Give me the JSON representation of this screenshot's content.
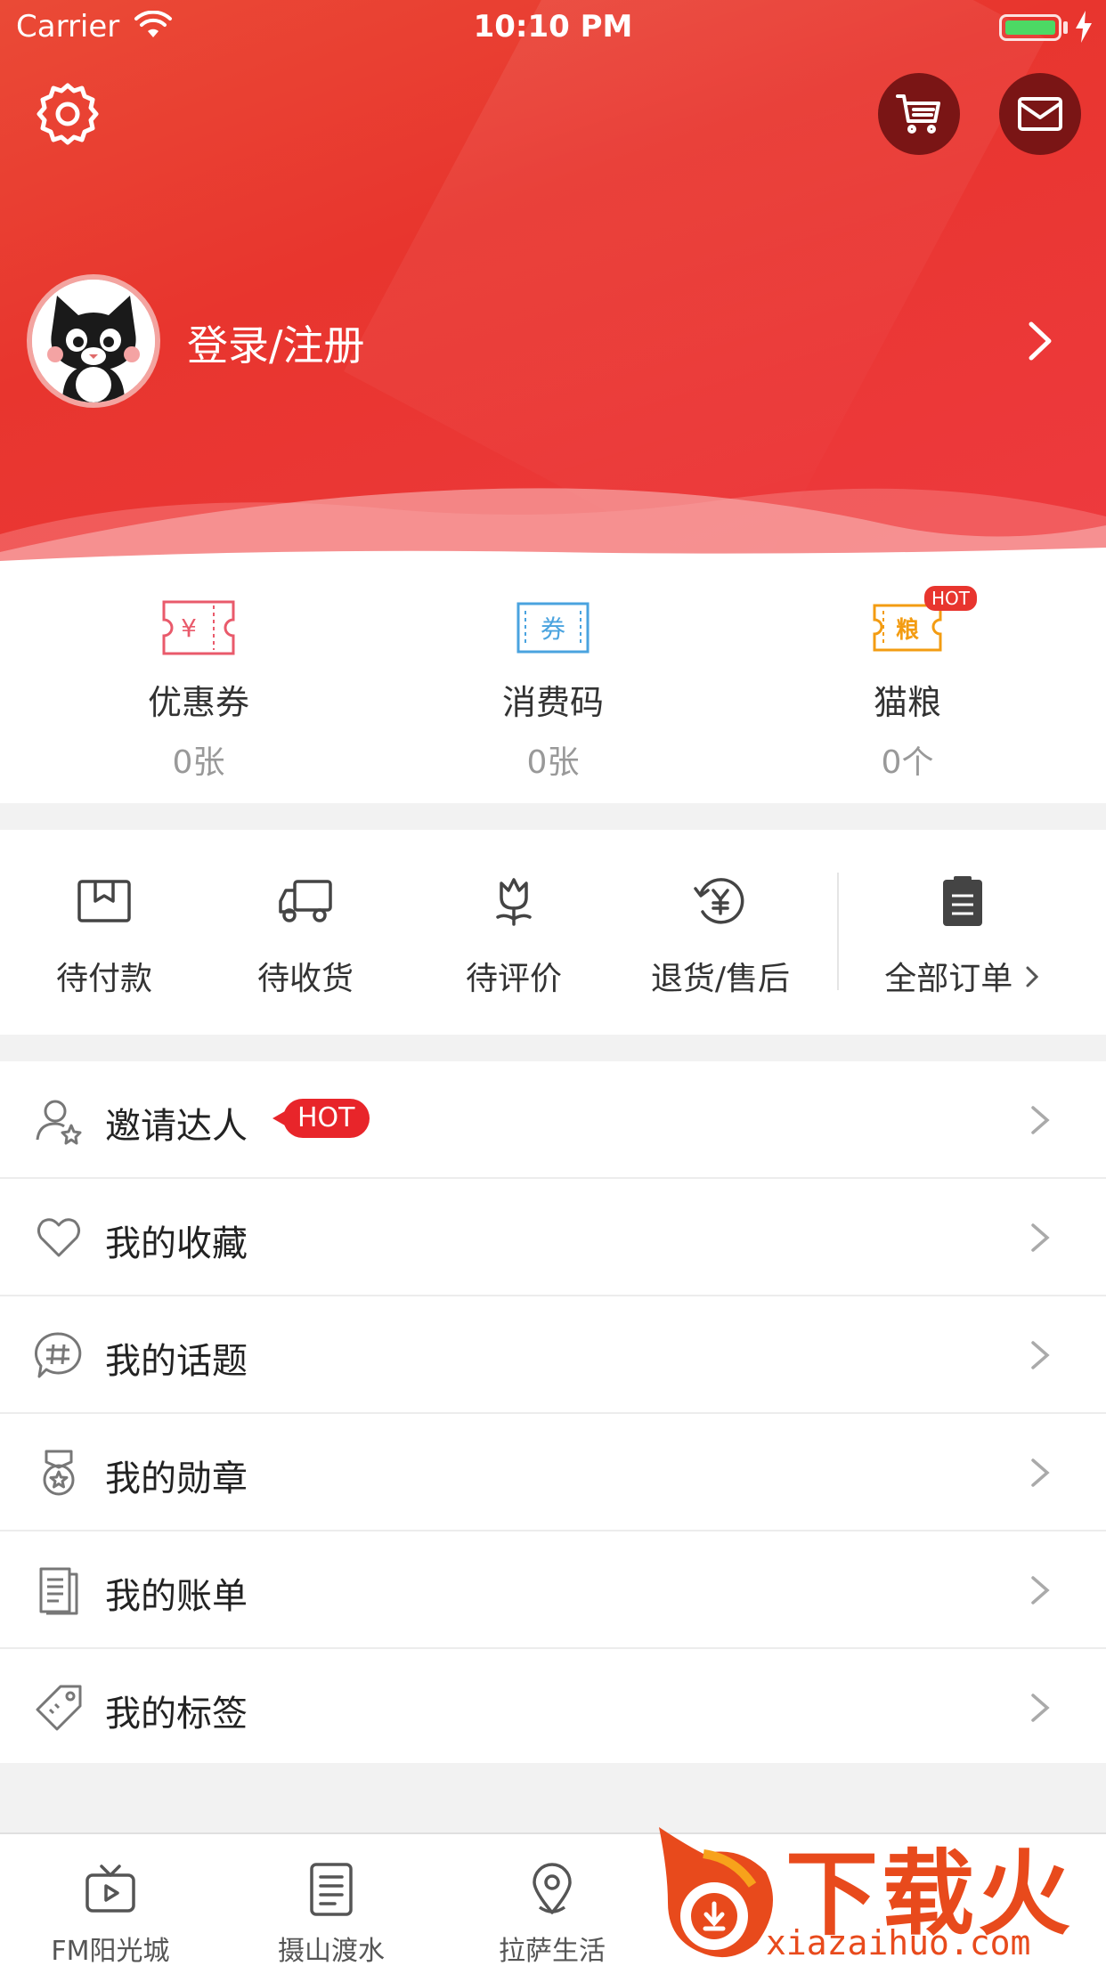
{
  "status_bar": {
    "carrier": "Carrier",
    "time": "10:10 PM"
  },
  "header": {
    "login_label": "登录/注册"
  },
  "stats": [
    {
      "label": "优惠券",
      "count": "0张",
      "icon": "coupon-icon",
      "icon_text": "¥"
    },
    {
      "label": "消费码",
      "count": "0张",
      "icon": "voucher-icon",
      "icon_text": "券"
    },
    {
      "label": "猫粮",
      "count": "0个",
      "icon": "cat-food-icon",
      "icon_text": "粮",
      "badge": "HOT"
    }
  ],
  "orders": [
    {
      "label": "待付款",
      "icon": "wallet-icon"
    },
    {
      "label": "待收货",
      "icon": "truck-icon"
    },
    {
      "label": "待评价",
      "icon": "flower-icon"
    },
    {
      "label": "退货/售后",
      "icon": "refund-icon"
    },
    {
      "label": "全部订单",
      "icon": "clipboard-icon"
    }
  ],
  "menu": [
    {
      "label": "邀请达人",
      "icon": "invite-user-icon",
      "badge": "HOT"
    },
    {
      "label": "我的收藏",
      "icon": "heart-icon"
    },
    {
      "label": "我的话题",
      "icon": "topic-hash-icon"
    },
    {
      "label": "我的勋章",
      "icon": "medal-icon"
    },
    {
      "label": "我的账单",
      "icon": "bill-icon"
    },
    {
      "label": "我的标签",
      "icon": "tag-icon"
    }
  ],
  "tabs": [
    {
      "label": "FM阳光城",
      "icon": "tv-play-icon"
    },
    {
      "label": "摄山渡水",
      "icon": "list-doc-icon"
    },
    {
      "label": "拉萨生活",
      "icon": "location-pin-icon"
    }
  ],
  "watermark": {
    "title": "下载火",
    "url": "xiazaihuo.com"
  },
  "colors": {
    "primary_red": "#e8352e",
    "hot_red": "#e8252a",
    "coupon_pink": "#e95a6b",
    "voucher_blue": "#4aa3df",
    "food_orange": "#f39c12"
  }
}
